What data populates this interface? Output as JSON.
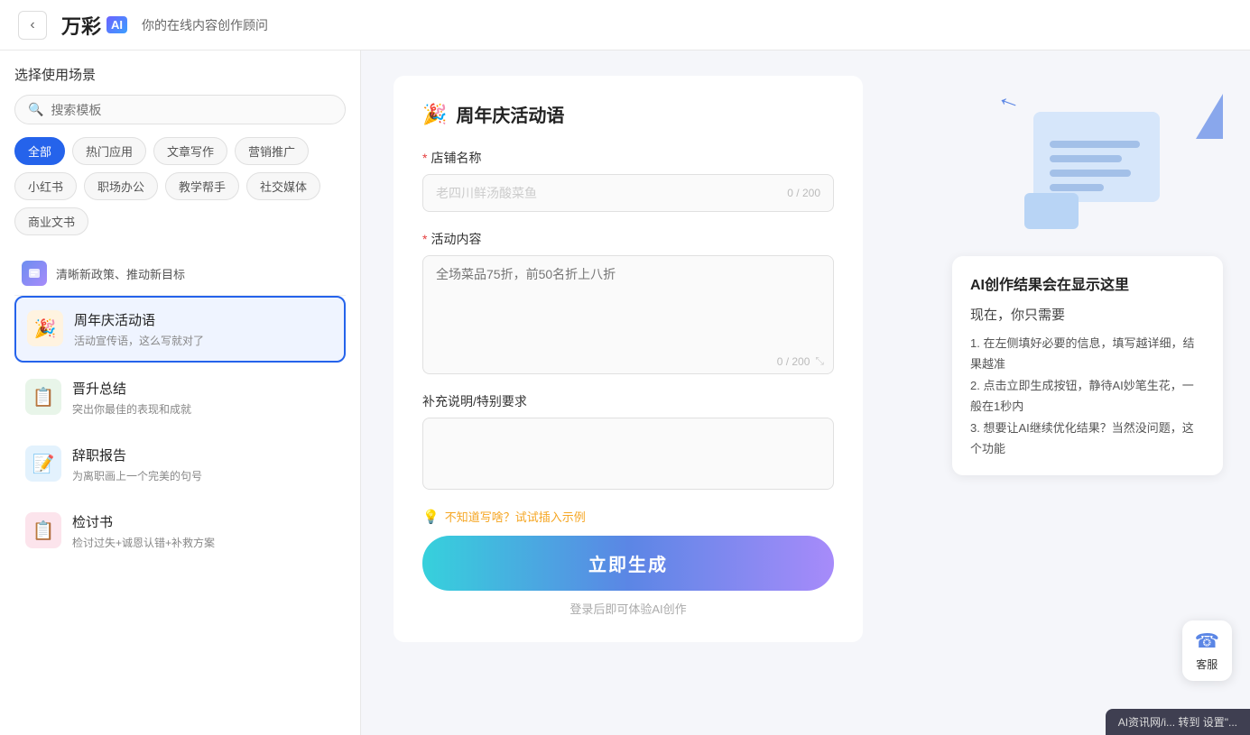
{
  "header": {
    "back_label": "‹",
    "logo_text": "万彩",
    "logo_ai": "A|",
    "subtitle": "你的在线内容创作顾问"
  },
  "sidebar": {
    "title": "选择使用场景",
    "search_placeholder": "搜索模板",
    "tags": [
      {
        "label": "全部",
        "active": true
      },
      {
        "label": "热门应用",
        "active": false
      },
      {
        "label": "文章写作",
        "active": false
      },
      {
        "label": "营销推广",
        "active": false
      },
      {
        "label": "小红书",
        "active": false
      },
      {
        "label": "职场办公",
        "active": false
      },
      {
        "label": "教学帮手",
        "active": false
      },
      {
        "label": "社交媒体",
        "active": false
      },
      {
        "label": "商业文书",
        "active": false
      }
    ],
    "policy_item_text": "清晰新政策、推动新目标",
    "items": [
      {
        "id": "anniversary",
        "icon": "🎉",
        "icon_class": "icon-celebration",
        "title": "周年庆活动语",
        "desc": "活动宣传语，这么写就对了",
        "selected": true
      },
      {
        "id": "promotion",
        "icon": "📋",
        "icon_class": "icon-promotion",
        "title": "晋升总结",
        "desc": "突出你最佳的表现和成就",
        "selected": false
      },
      {
        "id": "resignation",
        "icon": "📝",
        "icon_class": "icon-resignation",
        "title": "辞职报告",
        "desc": "为离职画上一个完美的句号",
        "selected": false
      },
      {
        "id": "review",
        "icon": "📋",
        "icon_class": "icon-review",
        "title": "检讨书",
        "desc": "检讨过失+诚恩认错+补救方案",
        "selected": false
      }
    ]
  },
  "form": {
    "title": "周年庆活动语",
    "title_icon": "🎉",
    "fields": {
      "shop_name": {
        "label": "店铺名称",
        "required": true,
        "placeholder": "老四川鲜汤酸菜鱼",
        "counter": "0 / 200"
      },
      "activity_content": {
        "label": "活动内容",
        "required": true,
        "placeholder": "全场菜品75折，前50名折上八折",
        "counter": "0 / 200"
      },
      "supplement": {
        "label": "补充说明/特别要求",
        "required": false,
        "placeholder": ""
      }
    },
    "hint_text": "不知道写啥？试试插入示例",
    "hint_icon": "💡",
    "generate_btn": "立即生成",
    "login_hint": "登录后即可体验AI创作"
  },
  "right_panel": {
    "ai_hint": {
      "arrow": "←",
      "title": "AI创作结果会在显示这里",
      "subtitle": "现在，你只需要",
      "steps": [
        "1. 在左侧填好必要的信息，填写越详细，结果越准",
        "2. 点击立即生成按钮，静待AI妙笔生花，一般在1秒内",
        "3. 想要让AI继续优化结果？当然没问题，这个功能"
      ]
    }
  },
  "customer_service": {
    "icon": "☎",
    "label": "客服"
  },
  "bottom_bar": {
    "text": "AI资讯网/i... 转到 设置\"..."
  }
}
